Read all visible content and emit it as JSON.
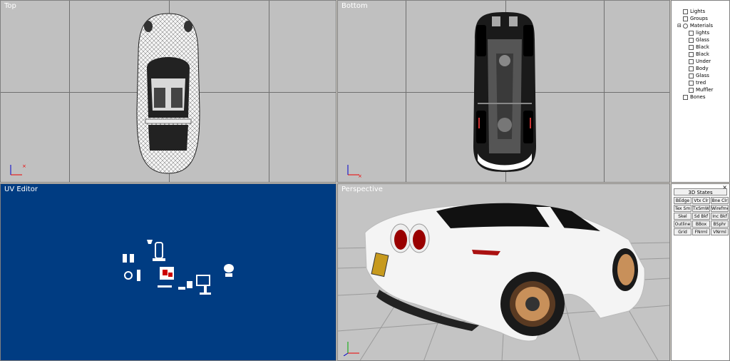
{
  "viewports": {
    "top": "Top",
    "bottom": "Bottom",
    "uv": "UV Editor",
    "perspective": "Perspective"
  },
  "scene_tree": {
    "items": [
      "Lights",
      "Groups",
      "Materials",
      "lights",
      "Glass",
      "Black",
      "Black",
      "Under",
      "Body",
      "Glass",
      "tred",
      "Muffler",
      "Bones"
    ]
  },
  "states_panel": {
    "title": "3D States",
    "buttons": [
      "BEdge",
      "Vtx Clr",
      "Bne Clr",
      "Tex Sm",
      "TxSmWr",
      "Wirefme",
      "Skel",
      "Sd Bkf",
      "Inc Bkf",
      "Outline",
      "BBox",
      "BSphr",
      "Grid",
      "FNrml",
      "VNrml"
    ]
  },
  "colors": {
    "viewport_bg": "#c0c0c0",
    "uv_bg": "#003c82",
    "panel_bg": "#d4d0c8"
  }
}
